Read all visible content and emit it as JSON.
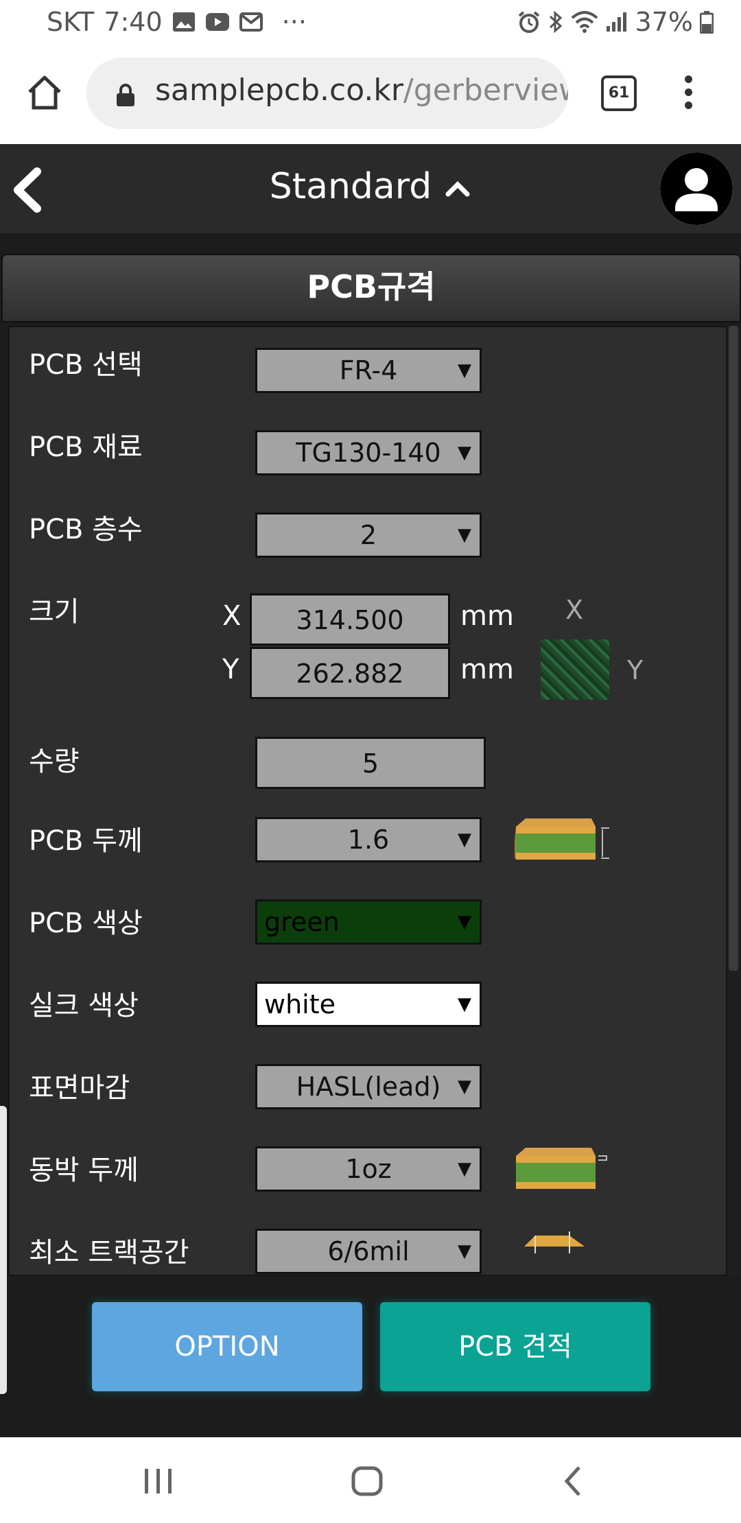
{
  "status_bar": {
    "carrier": "SKT",
    "time": "7:40",
    "more": "···",
    "battery": "37%"
  },
  "browser": {
    "url_domain": "samplepcb.co.kr",
    "url_path": "/gerberview",
    "tab_count": "61"
  },
  "header": {
    "title": "Standard"
  },
  "panel": {
    "title": "PCB규격"
  },
  "form": {
    "pcb_select": {
      "label": "PCB 선택",
      "value": "FR-4"
    },
    "pcb_material": {
      "label": "PCB 재료",
      "value": "TG130-140"
    },
    "pcb_layers": {
      "label": "PCB 층수",
      "value": "2"
    },
    "size": {
      "label": "크기",
      "x_axis": "X",
      "y_axis": "Y",
      "x_value": "314.500",
      "y_value": "262.882",
      "unit": "mm",
      "preview_x": "X",
      "preview_y": "Y"
    },
    "quantity": {
      "label": "수량",
      "value": "5"
    },
    "pcb_thickness": {
      "label": "PCB 두께",
      "value": "1.6"
    },
    "pcb_color": {
      "label": "PCB 색상",
      "value": "green"
    },
    "silk_color": {
      "label": "실크 색상",
      "value": "white"
    },
    "surface_finish": {
      "label": "표면마감",
      "value": "HASL(lead)"
    },
    "copper_thickness": {
      "label": "동박 두께",
      "value": "1oz"
    },
    "min_track": {
      "label": "최소 트랙공간",
      "value": "6/6mil"
    }
  },
  "buttons": {
    "option": "OPTION",
    "quote": "PCB 견적"
  },
  "colors": {
    "button_option": "#5da6e0",
    "button_quote": "#0aa394",
    "pcb_color_green": "#0c3e0c"
  }
}
